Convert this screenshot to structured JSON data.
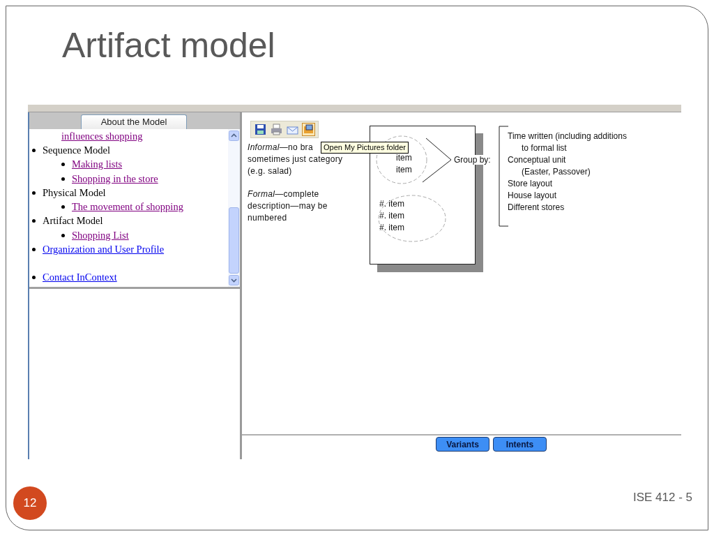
{
  "slide": {
    "title": "Artifact model",
    "number": "12",
    "footer": "ISE 412 - 5"
  },
  "left_panel": {
    "tab": "About the Model",
    "scrolled_fragment": {
      "text": "influences shopping",
      "visited": true
    },
    "items": [
      {
        "kind": "text",
        "text": "Sequence Model",
        "children": [
          {
            "text": "Making lists",
            "visited": true
          },
          {
            "text": "Shopping in the store",
            "visited": true
          }
        ]
      },
      {
        "kind": "text",
        "text": "Physical Model",
        "children": [
          {
            "text": "The movement of shopping",
            "visited": true
          }
        ]
      },
      {
        "kind": "text",
        "text": "Artifact Model",
        "children": [
          {
            "text": "Shopping List",
            "visited": true
          }
        ]
      },
      {
        "kind": "link",
        "text": "Organization and User Profile",
        "visited": false
      }
    ],
    "after_gap": [
      {
        "text": "Contact InContext",
        "visited": false
      }
    ]
  },
  "tooltip": "Open My Pictures folder",
  "notes": [
    {
      "lines": [
        "*Informal*—no bra",
        "sometimes just category",
        "(e.g. salad)"
      ]
    },
    {
      "lines": [
        "*Formal*—complete",
        "description—may be",
        "numbered"
      ]
    }
  ],
  "diagram": {
    "informal_items": [
      "item",
      "item"
    ],
    "formal_items": [
      "#. item",
      "#. item",
      "#. item"
    ],
    "group_label": "Group by:",
    "group_lines": [
      {
        "kind": "main",
        "text": "Time written (including additions"
      },
      {
        "kind": "continuation",
        "text": "to formal list"
      },
      {
        "kind": "main",
        "text": "Conceptual unit"
      },
      {
        "kind": "continuation",
        "text": "(Easter, Passover)"
      },
      {
        "kind": "main",
        "text": "Store layout"
      },
      {
        "kind": "main",
        "text": "House layout"
      },
      {
        "kind": "main",
        "text": "Different stores"
      }
    ]
  },
  "buttons": [
    "Variants",
    "Intents"
  ]
}
